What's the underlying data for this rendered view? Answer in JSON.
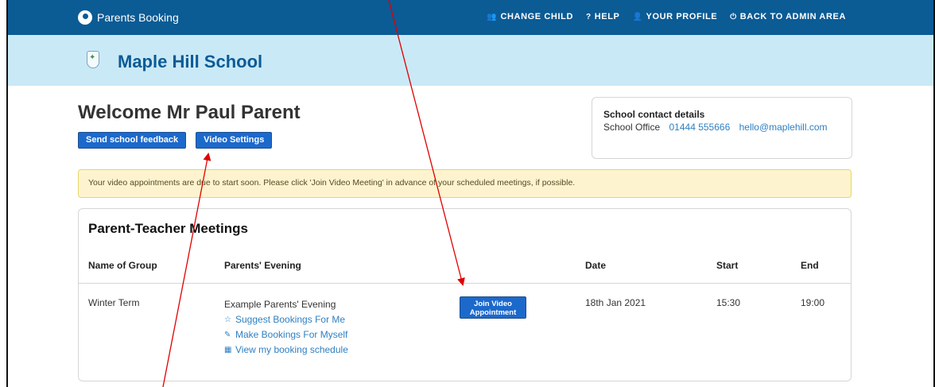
{
  "topbar": {
    "brand": "Parents Booking",
    "nav": [
      {
        "icon": "users-icon",
        "glyph": "👥",
        "label": "CHANGE CHILD"
      },
      {
        "icon": "help-icon",
        "glyph": "?",
        "label": "HELP"
      },
      {
        "icon": "user-icon",
        "glyph": "👤",
        "label": "YOUR PROFILE"
      },
      {
        "icon": "power-icon",
        "glyph": "⏻",
        "label": "BACK TO ADMIN AREA"
      }
    ]
  },
  "school": {
    "name": "Maple Hill School"
  },
  "welcome": {
    "text": "Welcome Mr Paul Parent",
    "feedback_button": "Send school feedback",
    "video_settings_button": "Video Settings"
  },
  "contact": {
    "title": "School contact details",
    "label": "School Office",
    "phone": "01444 555666",
    "email": "hello@maplehill.com"
  },
  "alert": {
    "text": "Your video appointments are due to start soon. Please click 'Join Video Meeting' in advance of your scheduled meetings, if possible."
  },
  "meetings": {
    "title": "Parent-Teacher Meetings",
    "headers": {
      "group": "Name of Group",
      "evening": "Parents' Evening",
      "date": "Date",
      "start": "Start",
      "end": "End"
    },
    "row": {
      "group": "Winter Term",
      "evening": "Example Parents' Evening",
      "join_button": "Join Video Appointment",
      "date": "18th Jan 2021",
      "start": "15:30",
      "end": "19:00",
      "links": [
        {
          "icon": "star-icon",
          "glyph": "☆",
          "label": "Suggest Bookings For Me"
        },
        {
          "icon": "pencil-icon",
          "glyph": "✎",
          "label": "Make Bookings For Myself"
        },
        {
          "icon": "calendar-icon",
          "glyph": "▦",
          "label": "View my booking schedule"
        }
      ]
    }
  },
  "colors": {
    "topbar": "#0b5b95",
    "schoolbar": "#c9e9f7",
    "button": "#1c69cc",
    "link": "#2f7fc1",
    "alert_bg": "#fdf4cf",
    "annotation_arrow": "#e00000"
  }
}
